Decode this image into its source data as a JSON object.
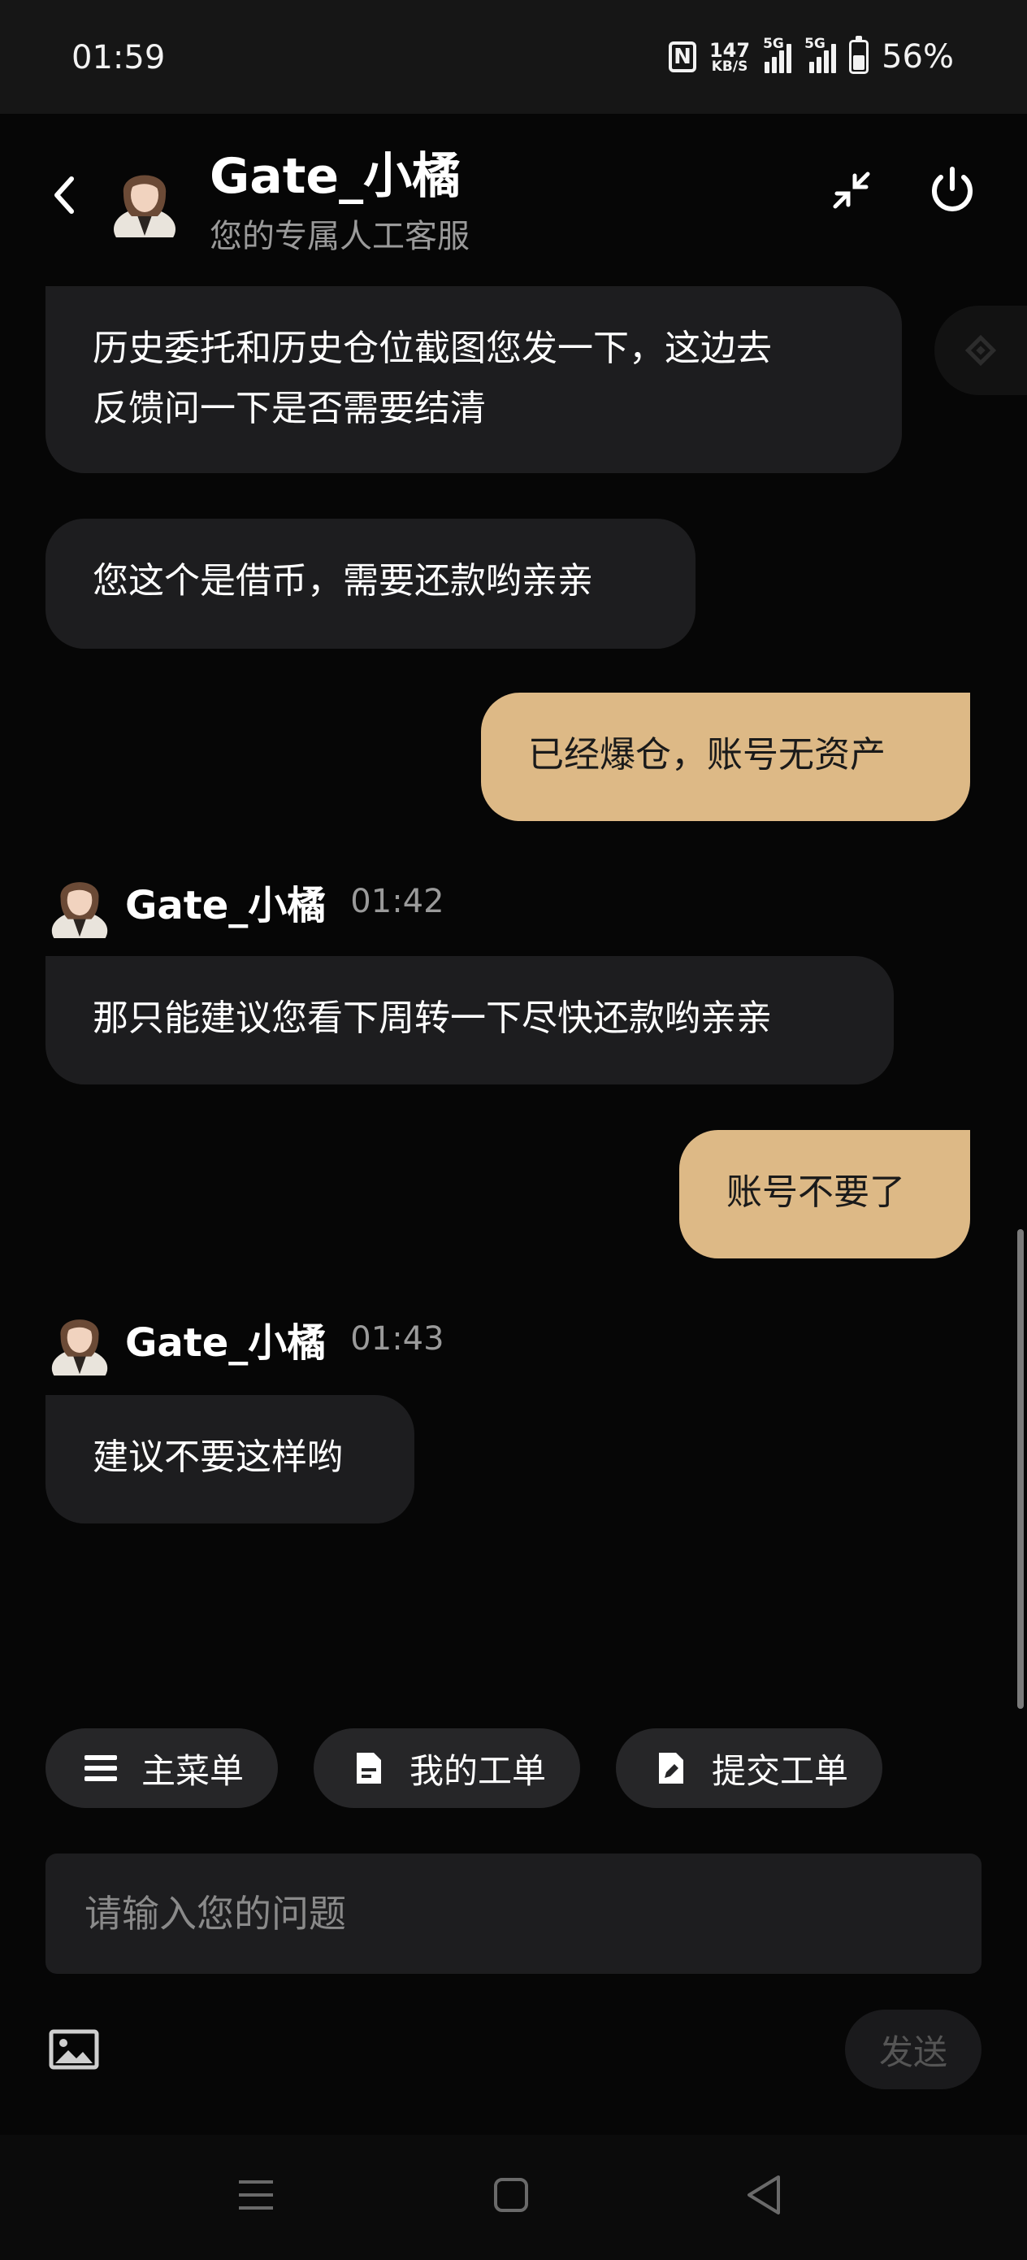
{
  "status_bar": {
    "time": "01:59",
    "nfc": "N",
    "net_speed_value": "147",
    "net_speed_unit": "KB/S",
    "sim1_label": "5G",
    "sim2_label": "5G",
    "battery_level": 0.56,
    "battery_text": "56%"
  },
  "header": {
    "title": "Gate_小橘",
    "subtitle": "您的专属人工客服"
  },
  "messages": [
    {
      "role": "agent",
      "lines": [
        "历史委托和历史仓位截图您发一下，这边去",
        "反馈问一下是否需要结清"
      ]
    },
    {
      "role": "agent",
      "text": "您这个是借币，需要还款哟亲亲"
    },
    {
      "role": "user",
      "text": "已经爆仓，账号无资产"
    },
    {
      "role": "agent",
      "sender": "Gate_小橘",
      "time": "01:42",
      "text": "那只能建议您看下周转一下尽快还款哟亲亲"
    },
    {
      "role": "user",
      "text": "账号不要了"
    },
    {
      "role": "agent",
      "sender": "Gate_小橘",
      "time": "01:43",
      "text": "建议不要这样哟"
    }
  ],
  "quick_actions": [
    {
      "label": "主菜单",
      "icon": "menu-icon"
    },
    {
      "label": "我的工单",
      "icon": "document-icon"
    },
    {
      "label": "提交工单",
      "icon": "edit-document-icon"
    }
  ],
  "composer": {
    "placeholder": "请输入您的问题",
    "send_label": "发送"
  },
  "colors": {
    "background": "#060606",
    "agent_bubble": "#1d1d1f",
    "user_bubble": "#ddb986",
    "muted_text": "#9a9a9a"
  }
}
